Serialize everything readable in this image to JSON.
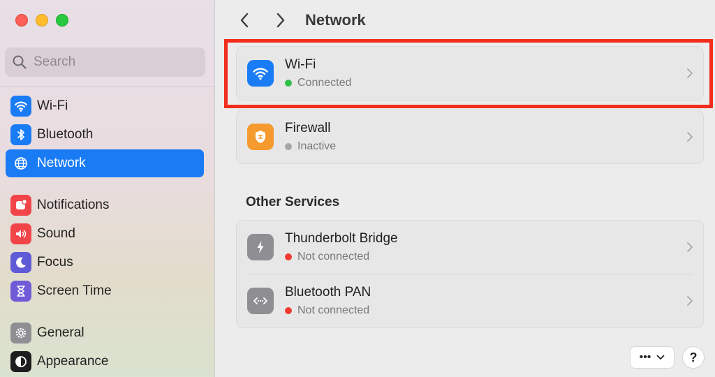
{
  "sidebar": {
    "search_placeholder": "Search",
    "items": [
      {
        "label": "Wi-Fi",
        "icon": "wifi-icon",
        "color": "#1a7cf5"
      },
      {
        "label": "Bluetooth",
        "icon": "bluetooth-icon",
        "color": "#1a7cf5"
      },
      {
        "label": "Network",
        "icon": "globe-icon",
        "color": "#1a7cf5",
        "active": true
      },
      {
        "label": "Notifications",
        "icon": "bell-icon",
        "color": "#f2454a"
      },
      {
        "label": "Sound",
        "icon": "speaker-icon",
        "color": "#f2454a"
      },
      {
        "label": "Focus",
        "icon": "moon-icon",
        "color": "#5f5ad6"
      },
      {
        "label": "Screen Time",
        "icon": "hourglass-icon",
        "color": "#6f5bd8"
      },
      {
        "label": "General",
        "icon": "gear-icon",
        "color": "#8e8e93"
      },
      {
        "label": "Appearance",
        "icon": "appearance-icon",
        "color": "#1d1d1f"
      }
    ]
  },
  "header": {
    "title": "Network"
  },
  "services": [
    {
      "title": "Wi-Fi",
      "status": "Connected",
      "status_color": "#30c04a",
      "icon": "wifi-icon",
      "icon_color": "#1a7cf5"
    },
    {
      "title": "Firewall",
      "status": "Inactive",
      "status_color": "#a6a6a6",
      "icon": "firewall-icon",
      "icon_color": "#f59a2f"
    }
  ],
  "other_services": {
    "title": "Other Services",
    "items": [
      {
        "title": "Thunderbolt Bridge",
        "status": "Not connected",
        "status_color": "#ef3b2f",
        "icon": "thunderbolt-icon",
        "icon_color": "#8e8e93"
      },
      {
        "title": "Bluetooth PAN",
        "status": "Not connected",
        "status_color": "#ef3b2f",
        "icon": "bluetooth-pan-icon",
        "icon_color": "#8e8e93"
      }
    ]
  },
  "footer": {
    "more_label": "•••",
    "help_label": "?"
  },
  "highlight_color": "#f22d1c"
}
